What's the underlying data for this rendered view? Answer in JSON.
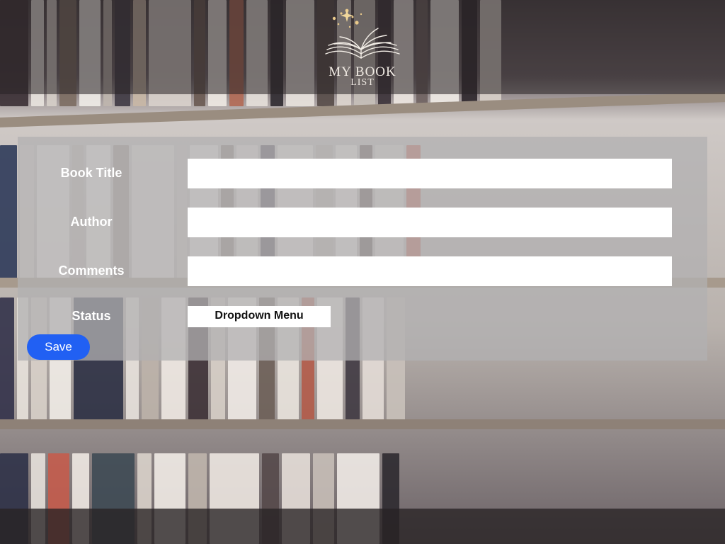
{
  "header": {
    "logo_title": "MY BOOK",
    "logo_subtitle": "LIST"
  },
  "form": {
    "book_title_label": "Book Title",
    "book_title_value": "",
    "author_label": "Author",
    "author_value": "",
    "comments_label": "Comments",
    "comments_value": "",
    "status_label": "Status",
    "status_dropdown": "Dropdown Menu",
    "save_label": "Save"
  },
  "colors": {
    "save_button": "#2160f3",
    "panel": "#b2b0b2",
    "header_bar": "#282224"
  },
  "icons": {
    "logo": "open-book-with-sparkles-icon"
  }
}
